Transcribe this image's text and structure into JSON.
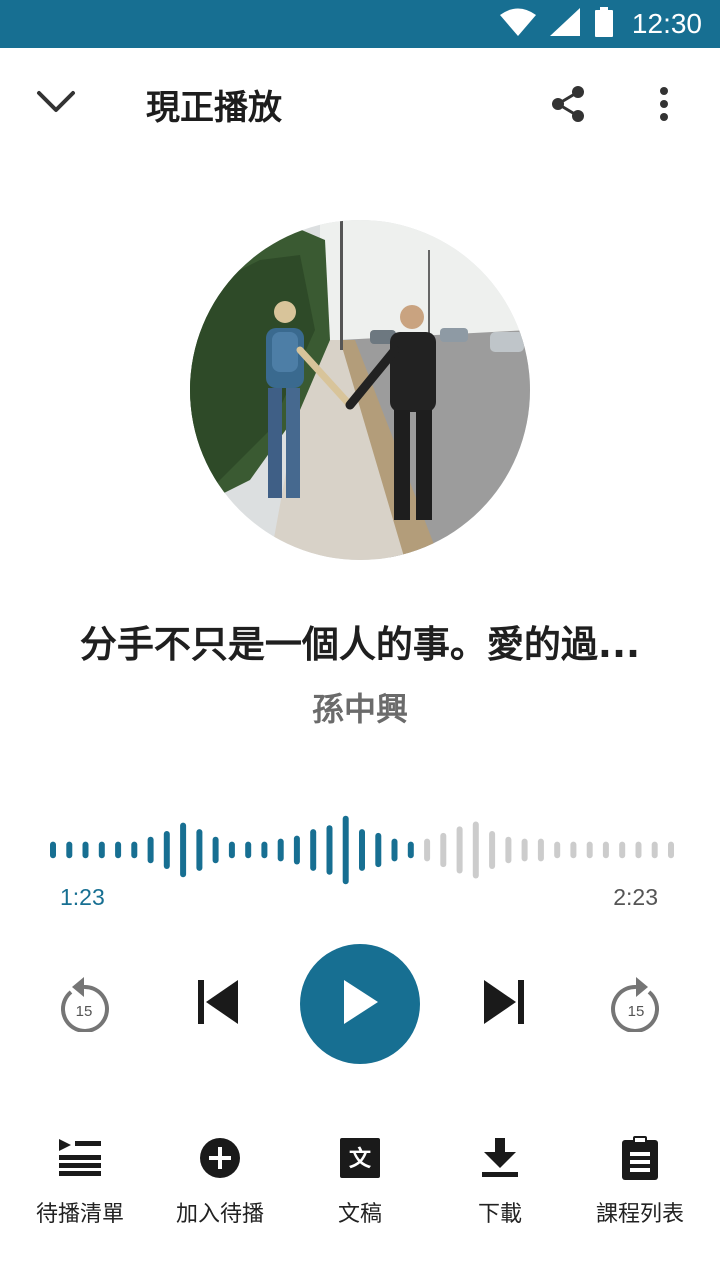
{
  "colors": {
    "accent": "#176f92",
    "played_bar": "#176f92",
    "unplayed_bar": "#cccccc",
    "text_primary": "#1f1f1f",
    "text_secondary": "#6b6b6b"
  },
  "status_bar": {
    "time": "12:30",
    "icons": [
      "wifi-icon",
      "cell-signal-icon",
      "battery-icon"
    ]
  },
  "header": {
    "title": "現正播放",
    "icons": [
      "chevron-down-icon",
      "share-icon",
      "more-vert-icon"
    ]
  },
  "episode": {
    "title": "分手不只是一個人的事。愛的過...",
    "author": "孫中興"
  },
  "player": {
    "current_time": "1:23",
    "total_time": "2:23",
    "rewind_seconds": "15",
    "forward_seconds": "15",
    "progress": 0.58,
    "waveform_levels": [
      0.22,
      0.22,
      0.22,
      0.22,
      0.22,
      0.22,
      0.35,
      0.5,
      0.72,
      0.55,
      0.35,
      0.22,
      0.22,
      0.22,
      0.3,
      0.38,
      0.55,
      0.65,
      0.9,
      0.55,
      0.45,
      0.3,
      0.22,
      0.3,
      0.45,
      0.62,
      0.75,
      0.5,
      0.35,
      0.3,
      0.3,
      0.22,
      0.22,
      0.22,
      0.22,
      0.22,
      0.22,
      0.22,
      0.22
    ]
  },
  "actions": [
    {
      "label": "待播清單",
      "icon": "queue-icon"
    },
    {
      "label": "加入待播",
      "icon": "add-circle-icon"
    },
    {
      "label": "文稿",
      "icon": "transcript-icon"
    },
    {
      "label": "下載",
      "icon": "download-icon"
    },
    {
      "label": "課程列表",
      "icon": "clipboard-list-icon"
    }
  ]
}
